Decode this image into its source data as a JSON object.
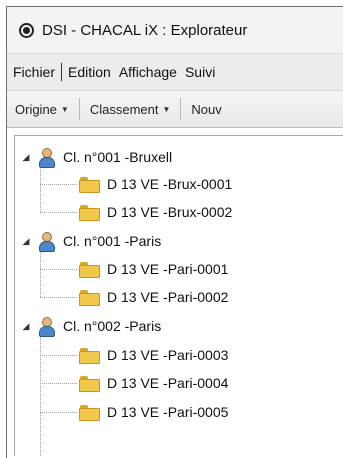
{
  "window": {
    "title": "DSI - CHACAL iX : Explorateur"
  },
  "menubar": {
    "items": [
      "Fichier",
      "Edition",
      "Affichage",
      "Suivi"
    ]
  },
  "toolbar": {
    "origine": "Origine",
    "classement": "Classement",
    "nouveau": "Nouv"
  },
  "tree": {
    "groups": [
      {
        "label": "Cl. n°001 -Bruxell",
        "children": [
          "D 13 VE -Brux-0001",
          "D 13 VE -Brux-0002"
        ]
      },
      {
        "label": "Cl. n°001 -Paris",
        "children": [
          "D 13 VE -Pari-0001",
          "D 13 VE -Pari-0002"
        ]
      },
      {
        "label": "Cl. n°002 -Paris",
        "children": [
          "D 13 VE -Pari-0003",
          "D 13 VE -Pari-0004",
          "D 13 VE -Pari-0005"
        ]
      }
    ]
  }
}
